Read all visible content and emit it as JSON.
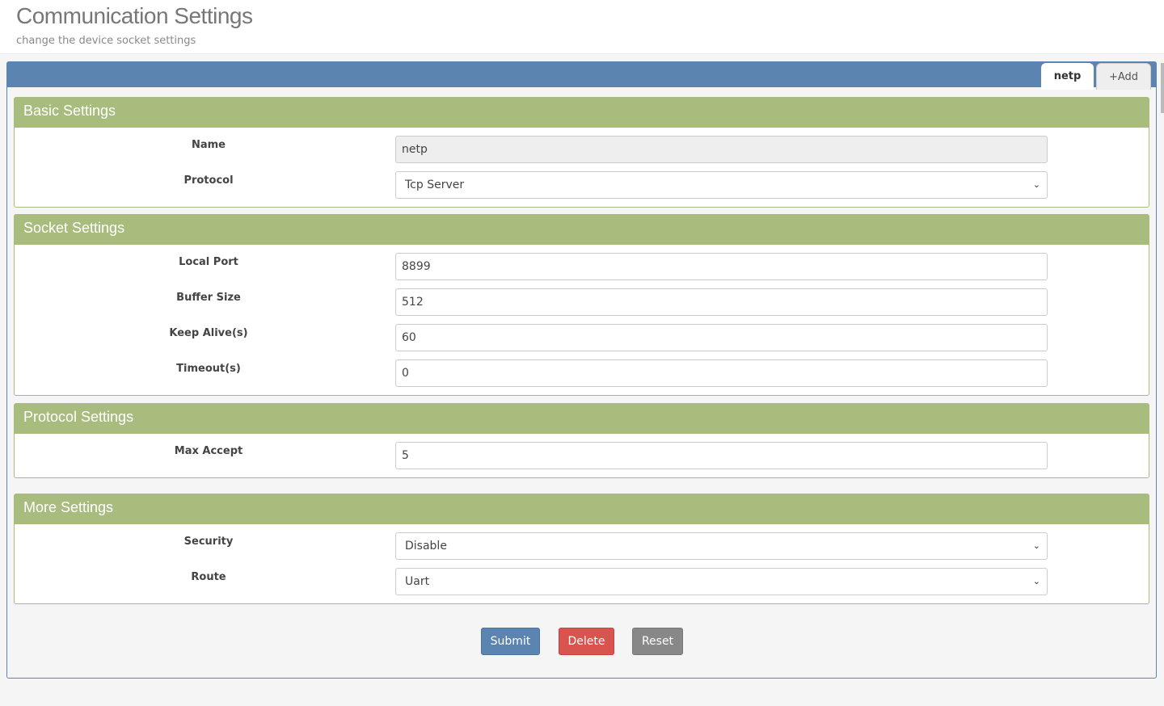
{
  "header": {
    "title": "Communication Settings",
    "subtitle": "change the device socket settings"
  },
  "tabs": [
    {
      "label": "netp",
      "active": true
    },
    {
      "label": "+Add"
    }
  ],
  "sections": [
    {
      "title": "Basic Settings",
      "fields": [
        {
          "label": "Name",
          "value": "netp",
          "type": "readonly"
        },
        {
          "label": "Protocol",
          "value": "Tcp Server",
          "type": "select"
        }
      ]
    },
    {
      "title": "Socket Settings",
      "fields": [
        {
          "label": "Local Port",
          "value": "8899"
        },
        {
          "label": "Buffer Size",
          "value": "512"
        },
        {
          "label": "Keep Alive(s)",
          "value": "60"
        },
        {
          "label": "Timeout(s)",
          "value": "0"
        }
      ]
    },
    {
      "title": "Protocol Settings",
      "fields": [
        {
          "label": "Max Accept",
          "value": "5"
        }
      ]
    },
    {
      "title": "More Settings",
      "fields": [
        {
          "label": "Security",
          "value": "Disable",
          "type": "select"
        },
        {
          "label": "Route",
          "value": "Uart",
          "type": "select"
        }
      ]
    }
  ],
  "buttons": {
    "submit": "Submit",
    "delete": "Delete",
    "reset": "Reset"
  },
  "colors": {
    "primary": "#5b85b0",
    "section": "#a7bc7d",
    "danger": "#d9534f",
    "neutral": "#888888"
  }
}
